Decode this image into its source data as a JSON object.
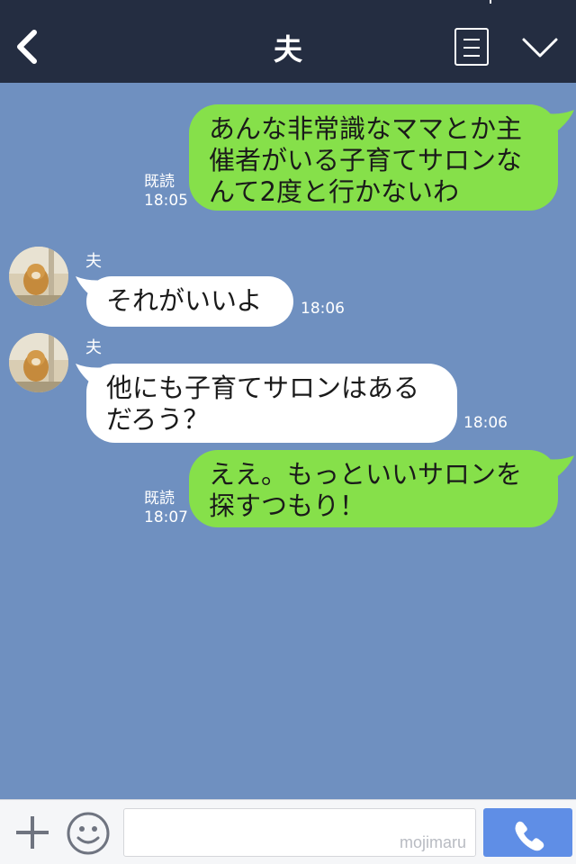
{
  "header": {
    "title": "夫"
  },
  "messages": [
    {
      "side": "mine",
      "text_lines": [
        "あんな非常識なママとか主",
        "催者がいる子育てサロンな",
        "んて2度と行かないわ"
      ],
      "read": "既読",
      "time": "18:05"
    },
    {
      "side": "theirs",
      "sender": "夫",
      "text_lines": [
        "それがいいよ"
      ],
      "time": "18:06"
    },
    {
      "side": "theirs",
      "sender": "夫",
      "text_lines": [
        "他にも子育てサロンはある",
        "だろう？"
      ],
      "time": "18:06"
    },
    {
      "side": "mine",
      "text_lines": [
        "ええ。もっといいサロンを",
        "探すつもり！"
      ],
      "read": "既読",
      "time": "18:07"
    }
  ],
  "footer": {
    "input_value": "",
    "watermark": "mojimaru"
  },
  "icons": [
    "back-icon",
    "menu-icon",
    "chevron-down-icon",
    "plus-icon",
    "emoji-icon",
    "phone-icon"
  ],
  "colors": {
    "header_bg": "#242d41",
    "chat_bg": "#6f90c0",
    "my_bubble": "#86e04a",
    "their_bubble": "#ffffff",
    "call_button": "#5f8ee6"
  }
}
